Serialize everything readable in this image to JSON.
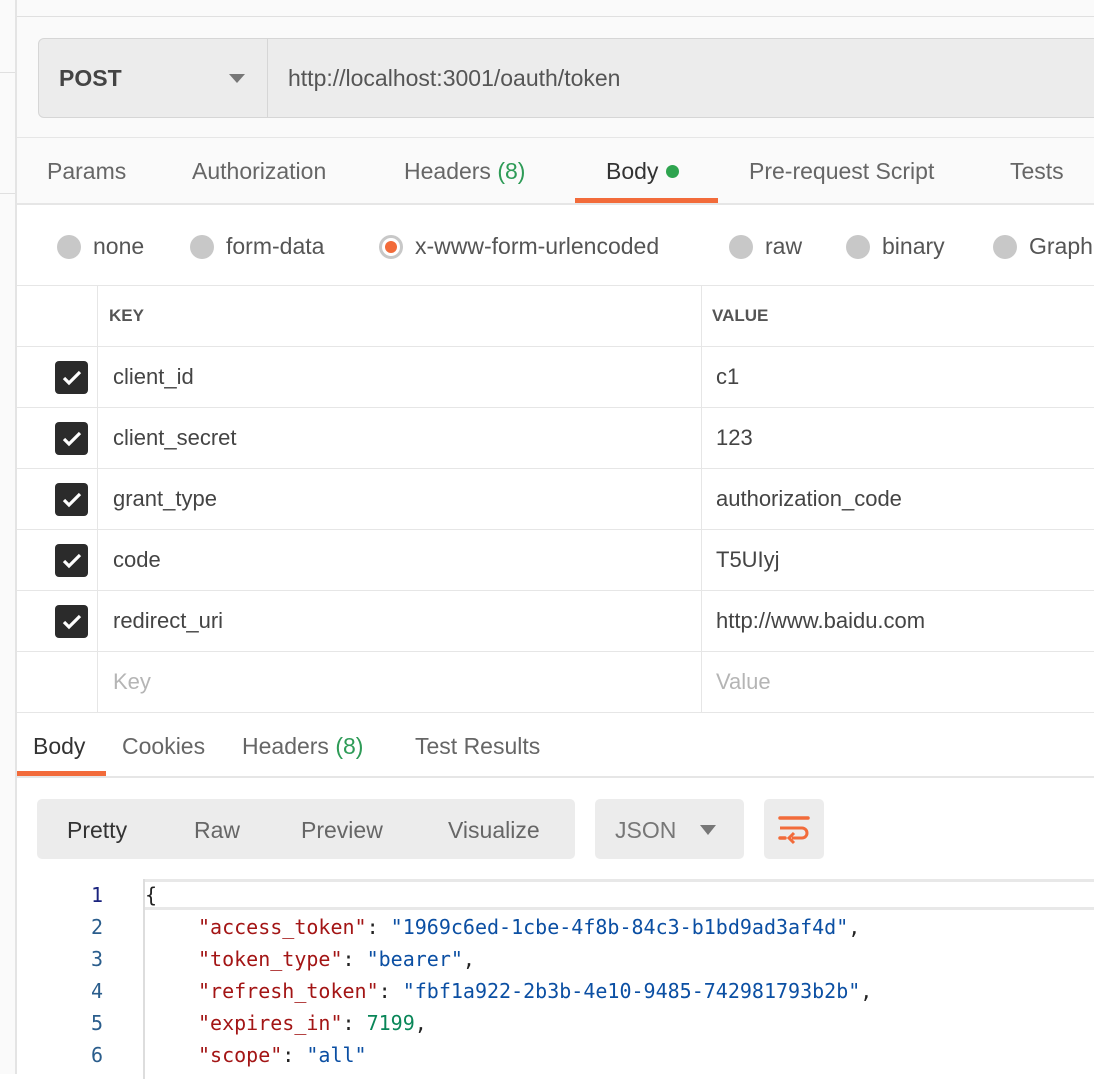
{
  "request": {
    "method": "POST",
    "url": "http://localhost:3001/oauth/token",
    "tabs": [
      {
        "label": "Params"
      },
      {
        "label": "Authorization"
      },
      {
        "label": "Headers",
        "count": "(8)"
      },
      {
        "label": "Body",
        "active": true,
        "indicator": "green-dot"
      },
      {
        "label": "Pre-request Script"
      },
      {
        "label": "Tests"
      }
    ],
    "body_types": [
      "none",
      "form-data",
      "x-www-form-urlencoded",
      "raw",
      "binary",
      "GraphQL"
    ],
    "body_type_selected": "x-www-form-urlencoded",
    "table": {
      "headers": {
        "key": "KEY",
        "value": "VALUE"
      },
      "rows": [
        {
          "key": "client_id",
          "value": "c1",
          "checked": true
        },
        {
          "key": "client_secret",
          "value": "123",
          "checked": true
        },
        {
          "key": "grant_type",
          "value": "authorization_code",
          "checked": true
        },
        {
          "key": "code",
          "value": "T5UIyj",
          "checked": true
        },
        {
          "key": "redirect_uri",
          "value": "http://www.baidu.com",
          "checked": true
        }
      ],
      "placeholder": {
        "key": "Key",
        "value": "Value"
      }
    }
  },
  "response": {
    "tabs": [
      {
        "label": "Body",
        "active": true
      },
      {
        "label": "Cookies"
      },
      {
        "label": "Headers",
        "count": "(8)"
      },
      {
        "label": "Test Results"
      }
    ],
    "views": [
      "Pretty",
      "Raw",
      "Preview",
      "Visualize"
    ],
    "active_view": "Pretty",
    "format": "JSON",
    "wrap_icon": "wrap-lines-icon",
    "code": {
      "line_numbers": [
        "1",
        "2",
        "3",
        "4",
        "5",
        "6"
      ],
      "open_brace": "{",
      "fields": [
        {
          "key": "\"access_token\"",
          "value": "\"1969c6ed-1cbe-4f8b-84c3-b1bd9ad3af4d\"",
          "type": "str",
          "trail": ","
        },
        {
          "key": "\"token_type\"",
          "value": "\"bearer\"",
          "type": "str",
          "trail": ","
        },
        {
          "key": "\"refresh_token\"",
          "value": "\"fbf1a922-2b3b-4e10-9485-742981793b2b\"",
          "type": "str",
          "trail": ","
        },
        {
          "key": "\"expires_in\"",
          "value": "7199",
          "type": "num",
          "trail": ","
        },
        {
          "key": "\"scope\"",
          "value": "\"all\"",
          "type": "str",
          "trail": ""
        }
      ]
    }
  },
  "colors": {
    "accent": "#f26b3a",
    "count": "#2e9b57",
    "json_key": "#a31515",
    "json_string": "#0b4fa3",
    "json_number": "#098658"
  }
}
